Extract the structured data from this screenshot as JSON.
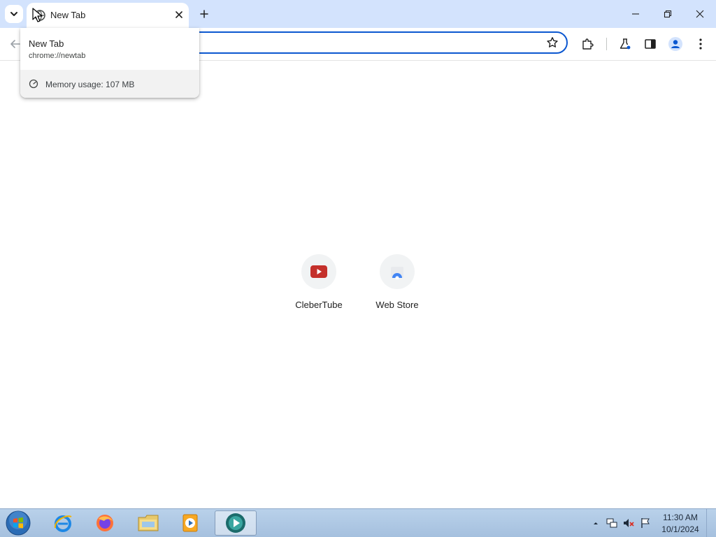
{
  "window": {
    "tab": {
      "title": "New Tab",
      "icon": "newtab-globe-icon"
    },
    "controls": [
      "minimize",
      "restore",
      "close"
    ]
  },
  "hover_card": {
    "title": "New Tab",
    "url": "chrome://newtab",
    "memory_label": "Memory usage: 107 MB"
  },
  "toolbar": {
    "omnibox_value": "",
    "icons": [
      "back-icon",
      "bookmark-star-icon",
      "extensions-icon",
      "labs-flask-icon",
      "side-panel-icon",
      "profile-icon",
      "menu-icon"
    ]
  },
  "shortcuts": [
    {
      "label": "CleberTube",
      "icon": "youtube-icon"
    },
    {
      "label": "Web Store",
      "icon": "web-store-icon"
    }
  ],
  "taskbar": {
    "apps": [
      "internet-explorer-icon",
      "firefox-icon",
      "file-explorer-icon",
      "media-player-icon",
      "chrome-app-icon"
    ],
    "clock": {
      "time": "11:30 AM",
      "date": "10/1/2024"
    }
  },
  "colors": {
    "tabstrip": "#d3e3fd",
    "accent": "#0b57d0",
    "youtube_red": "#c4302b"
  }
}
